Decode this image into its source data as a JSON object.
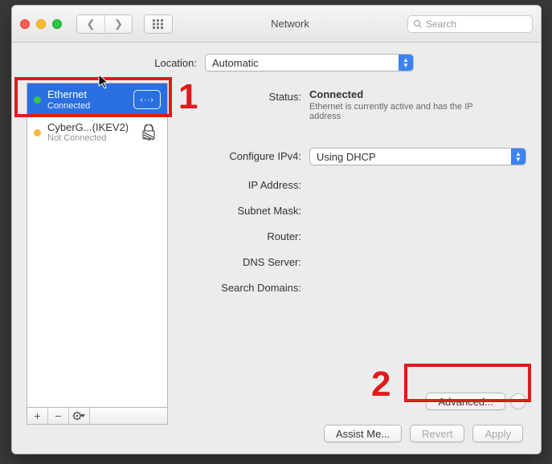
{
  "window_title": "Network",
  "search": {
    "placeholder": "Search"
  },
  "location": {
    "label": "Location:",
    "value": "Automatic"
  },
  "annotations": {
    "one": "1",
    "two": "2"
  },
  "sidebar": {
    "items": [
      {
        "name": "Ethernet",
        "status": "Connected"
      },
      {
        "name": "CyberG...(IKEV2)",
        "status": "Not Connected"
      }
    ],
    "toolbar": {
      "add": "+",
      "remove": "−",
      "gear": "✷▾"
    }
  },
  "details": {
    "status_label": "Status:",
    "status_value": "Connected",
    "status_desc": "Ethernet is currently active and has the IP address",
    "configure_label": "Configure IPv4:",
    "configure_value": "Using DHCP",
    "ip_label": "IP Address:",
    "subnet_label": "Subnet Mask:",
    "router_label": "Router:",
    "dns_label": "DNS Server:",
    "search_domains_label": "Search Domains:",
    "advanced_btn": "Advanced..."
  },
  "footer": {
    "assist": "Assist Me...",
    "revert": "Revert",
    "apply": "Apply"
  }
}
